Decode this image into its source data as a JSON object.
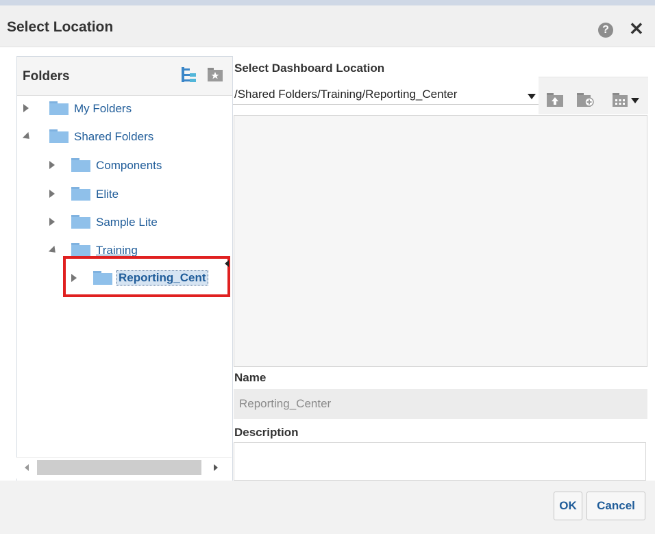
{
  "dialog": {
    "title": "Select Location",
    "help_icon": "question-circle-icon",
    "close_icon": "close-x-icon"
  },
  "folders": {
    "header": "Folders",
    "header_icons": [
      "tree-view-icon",
      "favorite-folder-icon"
    ],
    "tree": [
      {
        "label": "My Folders",
        "expanded": false
      },
      {
        "label": "Shared Folders",
        "expanded": true
      },
      {
        "label": "Components",
        "expanded": false
      },
      {
        "label": "Elite",
        "expanded": false
      },
      {
        "label": "Sample Lite",
        "expanded": false
      },
      {
        "label": "Training",
        "expanded": true
      },
      {
        "label": "Reporting_Cent",
        "expanded": false,
        "selected": true
      }
    ]
  },
  "location": {
    "label": "Select Dashboard Location",
    "path": "/Shared Folders/Training/Reporting_Center",
    "toolbar_icons": [
      "folder-up-icon",
      "new-folder-icon",
      "view-options-icon"
    ]
  },
  "name": {
    "label": "Name",
    "value": "Reporting_Center"
  },
  "description": {
    "label": "Description",
    "value": ""
  },
  "buttons": {
    "ok": "OK",
    "cancel": "Cancel"
  },
  "colors": {
    "link_blue": "#1f5c99",
    "folder_blue": "#8fc0ea",
    "highlight_red": "#e02020"
  }
}
